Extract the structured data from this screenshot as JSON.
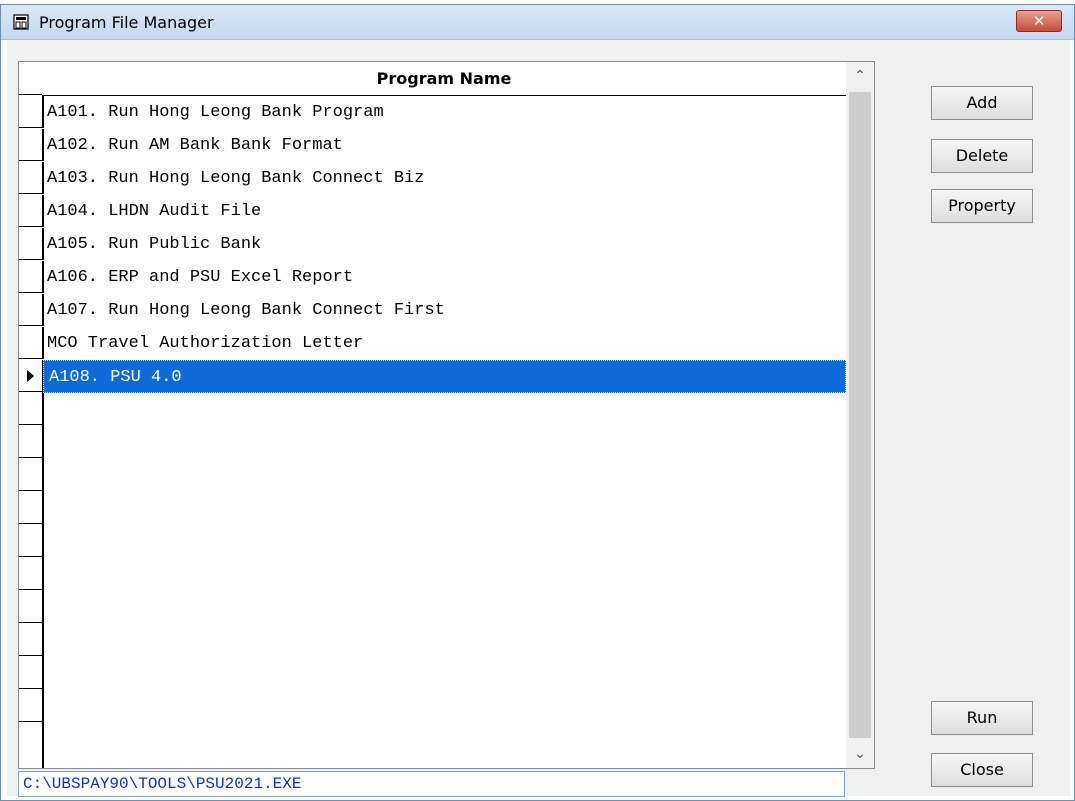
{
  "window": {
    "title": "Program File Manager",
    "close_glyph": "✕",
    "icon": "app-window-icon"
  },
  "grid": {
    "column_header": "Program Name",
    "rows": [
      "A101. Run Hong Leong Bank Program",
      "A102. Run AM Bank Bank Format",
      "A103. Run Hong Leong Bank Connect Biz",
      "A104. LHDN Audit File",
      "A105. Run Public Bank",
      "A106. ERP and PSU Excel Report",
      "A107. Run Hong Leong Bank Connect First",
      "MCO Travel Authorization Letter",
      "A108. PSU 4.0"
    ],
    "selected_index": 8,
    "scroll_up_glyph": "⌃",
    "scroll_down_glyph": "⌄"
  },
  "path": "C:\\UBSPAY90\\TOOLS\\PSU2021.EXE",
  "buttons": {
    "add": "Add",
    "delete": "Delete",
    "property": "Property",
    "run": "Run",
    "close": "Close"
  },
  "colors": {
    "selection": "#0d6ad6",
    "path_text": "#1030c8",
    "close_button": "#c74c38"
  }
}
